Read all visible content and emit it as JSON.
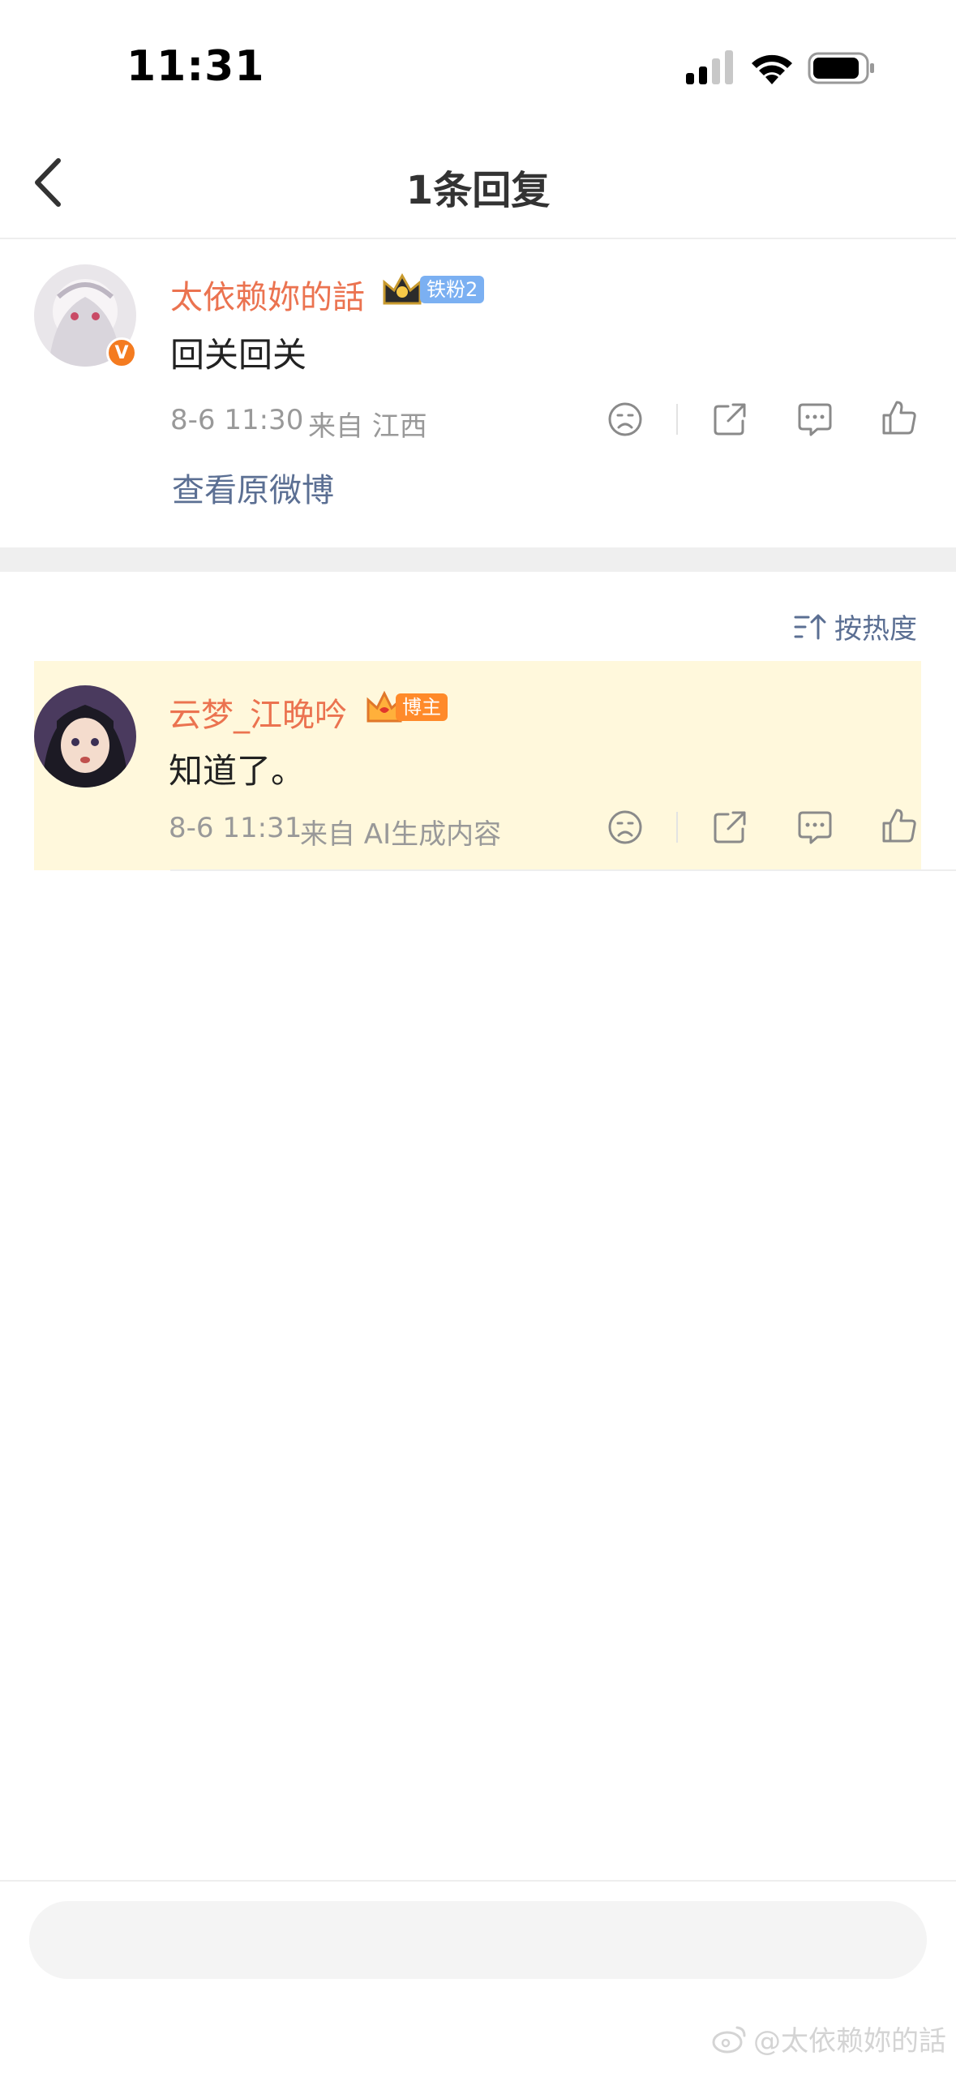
{
  "status_bar": {
    "time": "11:31"
  },
  "nav": {
    "title": "1条回复"
  },
  "original_comment": {
    "username": "太依赖妳的話",
    "fan_badge": "铁粉2",
    "text": "回关回关",
    "time": "8-6 11:30",
    "source": "来自 江西",
    "view_original": "查看原微博"
  },
  "sort": {
    "label": "按热度"
  },
  "reply": {
    "username": "云梦_江晚吟",
    "host_badge": "博主",
    "text": "知道了。",
    "time": "8-6 11:31",
    "source": "来自 AI生成内容"
  },
  "watermark": {
    "text": "@太依赖妳的話"
  },
  "colors": {
    "username": "#eb7350",
    "link": "#5b6f93",
    "highlight_bg": "#fff8dc",
    "fan_badge": "#7bb0f2",
    "host_badge": "#ff8a2a"
  }
}
